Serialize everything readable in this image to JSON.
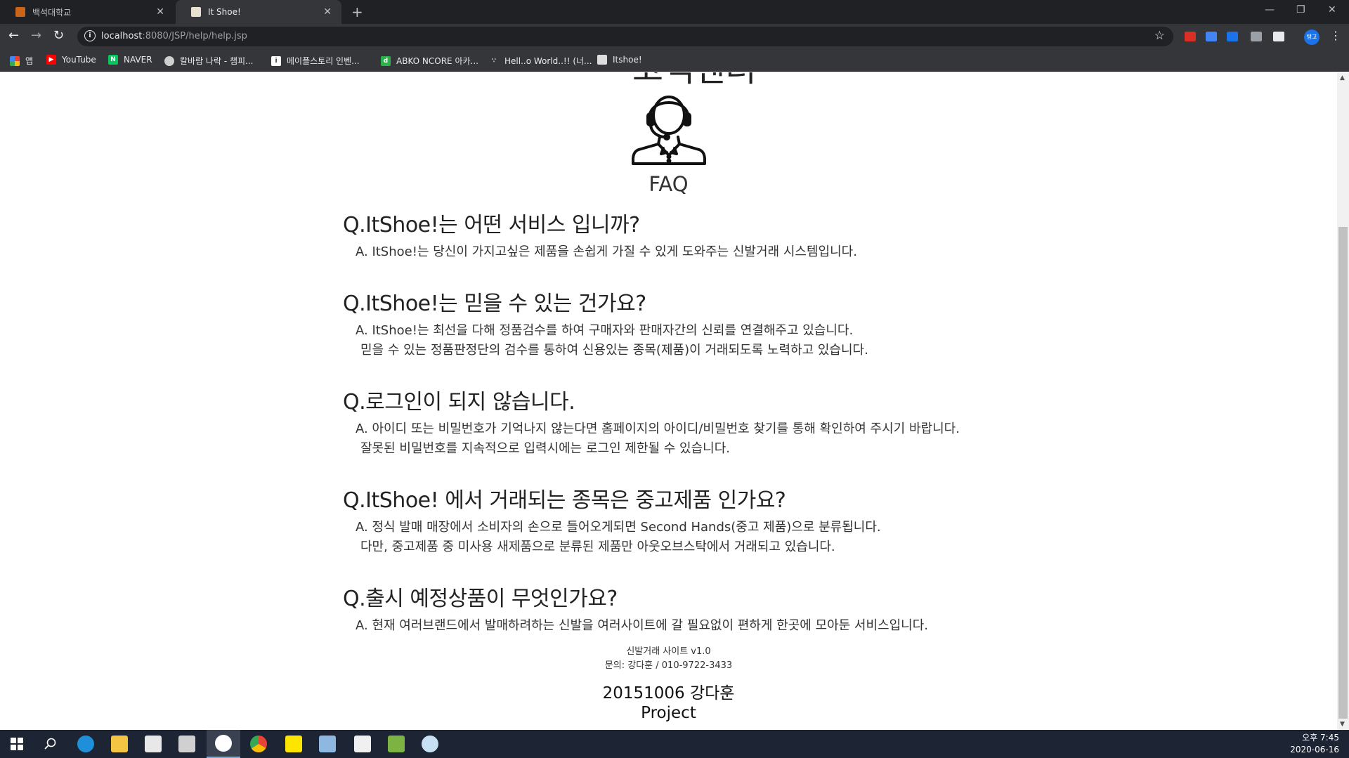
{
  "browser": {
    "tabs": [
      {
        "title": "백석대학교",
        "favicon": "school-icon",
        "active": false
      },
      {
        "title": "It Shoe!",
        "favicon": "shoe-icon",
        "active": true
      }
    ],
    "url_host": "localhost",
    "url_rest": ":8080/JSP/help/help.jsp",
    "profile_label": "탱고",
    "bookmarks": [
      {
        "label": "앱",
        "icon": "apps-grid-icon",
        "color": "#ea4335"
      },
      {
        "label": "YouTube",
        "icon": "youtube-icon",
        "color": "#ff0000"
      },
      {
        "label": "NAVER",
        "icon": "naver-icon",
        "color": "#03c75a"
      },
      {
        "label": "칼바람 나락 - 챔피...",
        "icon": "cloud-icon",
        "color": "#cccccc"
      },
      {
        "label": "메이플스토리 인벤...",
        "icon": "inven-icon",
        "color": "#ffffff"
      },
      {
        "label": "ABKO NCORE 아카...",
        "icon": "abko-icon",
        "color": "#2ab24b"
      },
      {
        "label": "Hell..o World..!! (너...",
        "icon": "dots-icon",
        "color": "#888888"
      },
      {
        "label": "Itshoe!",
        "icon": "shoe-icon",
        "color": "#dddddd"
      }
    ]
  },
  "page": {
    "cut_title": "고객센터",
    "faq_title": "FAQ",
    "faqs": [
      {
        "q": "Q.ItShoe!는 어떤 서비스 입니까?",
        "a": [
          "A. ItShoe!는 당신이 가지고싶은 제품을 손쉽게 가질 수 있게 도와주는 신발거래 시스템입니다."
        ]
      },
      {
        "q": "Q.ItShoe!는 믿을 수 있는 건가요?",
        "a": [
          "A. ItShoe!는 최선을 다해 정품검수를 하여 구매자와 판매자간의 신뢰를 연결해주고 있습니다.",
          "믿을 수 있는 정품판정단의 검수를 통하여 신용있는 종목(제품)이 거래되도록 노력하고 있습니다."
        ]
      },
      {
        "q": "Q.로그인이 되지 않습니다.",
        "a": [
          "A. 아이디 또는 비밀번호가 기억나지 않는다면 홈페이지의 아이디/비밀번호 찾기를 통해 확인하여 주시기 바랍니다.",
          "잘못된 비밀번호를 지속적으로 입력시에는 로그인 제한될 수 있습니다."
        ]
      },
      {
        "q": "Q.ItShoe! 에서 거래되는 종목은 중고제품 인가요?",
        "a": [
          "A. 정식 발매 매장에서 소비자의 손으로 들어오게되면 Second Hands(중고 제품)으로 분류됩니다.",
          "다만, 중고제품 중 미사용 새제품으로 분류된 제품만 아웃오브스탁에서 거래되고 있습니다."
        ]
      },
      {
        "q": "Q.출시 예정상품이 무엇인가요?",
        "a": [
          "A. 현재 여러브랜드에서 발매하려하는 신발을 여러사이트에 갈 필요없이 편하게 한곳에 모아둔 서비스입니다."
        ]
      }
    ],
    "footer": {
      "version": "신발거래 사이트 v1.0",
      "contact": "문의: 강다훈 / 010-9722-3433",
      "student": "20151006 강다훈",
      "project": "Project"
    }
  },
  "taskbar": {
    "time": "오후 7:45",
    "date": "2020-06-16",
    "apps": [
      "windows-start-icon",
      "search-icon",
      "internet-explorer-icon",
      "file-explorer-icon",
      "store-icon",
      "calculator-icon",
      "photos-icon",
      "chrome-icon",
      "kakaotalk-icon",
      "notepad-icon",
      "java-icon",
      "sticky-icon",
      "paint-icon"
    ]
  }
}
